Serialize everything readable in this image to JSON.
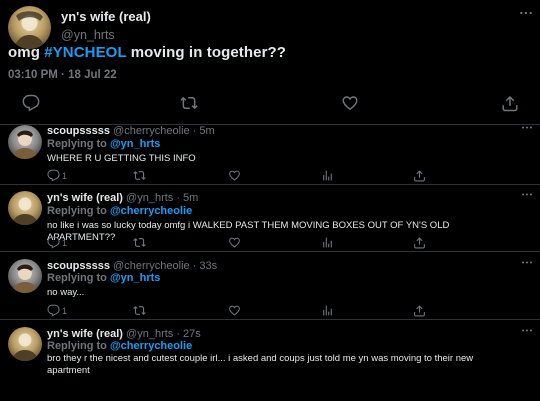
{
  "main_tweet": {
    "display_name": "yn's wife (real)",
    "handle": "@yn_hrts",
    "text_prefix": "omg ",
    "hashtag": "#YNCHEOL",
    "text_suffix": " moving in together??",
    "timestamp": "03:10 PM · 18 Jul 22"
  },
  "replies": [
    {
      "display_name": "scoupsssss",
      "meta": "@cherrycheolie · 5m",
      "replying_label": "Replying to ",
      "replying_to": "@yn_hrts",
      "text": "WHERE R U GETTING THIS INFO",
      "reply_count": "1"
    },
    {
      "display_name": "yn's wife (real)",
      "meta": "@yn_hrts · 5m",
      "replying_label": "Replying to ",
      "replying_to": "@cherrycheolie",
      "text": "no like i was so lucky today omfg i WALKED PAST THEM MOVING BOXES OUT OF YN'S OLD APARTMENT??",
      "reply_count": "1"
    },
    {
      "display_name": "scoupsssss",
      "meta": "@cherrycheolie · 33s",
      "replying_label": "Replying to ",
      "replying_to": "@yn_hrts",
      "text": "no way...",
      "reply_count": "1"
    },
    {
      "display_name": "yn's wife (real)",
      "meta": "@yn_hrts · 27s",
      "replying_label": "Replying to ",
      "replying_to": "@cherrycheolie",
      "text": "bro they r the nicest and cutest couple irl... i asked and coups just told me yn was moving to their new apartment",
      "reply_count": ""
    }
  ],
  "icons": {
    "reply": "reply-icon",
    "retweet": "retweet-icon",
    "like": "heart-icon",
    "views": "views-icon",
    "share": "share-icon",
    "more": "more-icon"
  },
  "colors": {
    "background": "#000000",
    "text": "#e7e9ea",
    "muted": "#71767b",
    "accent": "#1d9bf0",
    "divider": "#2f3336"
  }
}
